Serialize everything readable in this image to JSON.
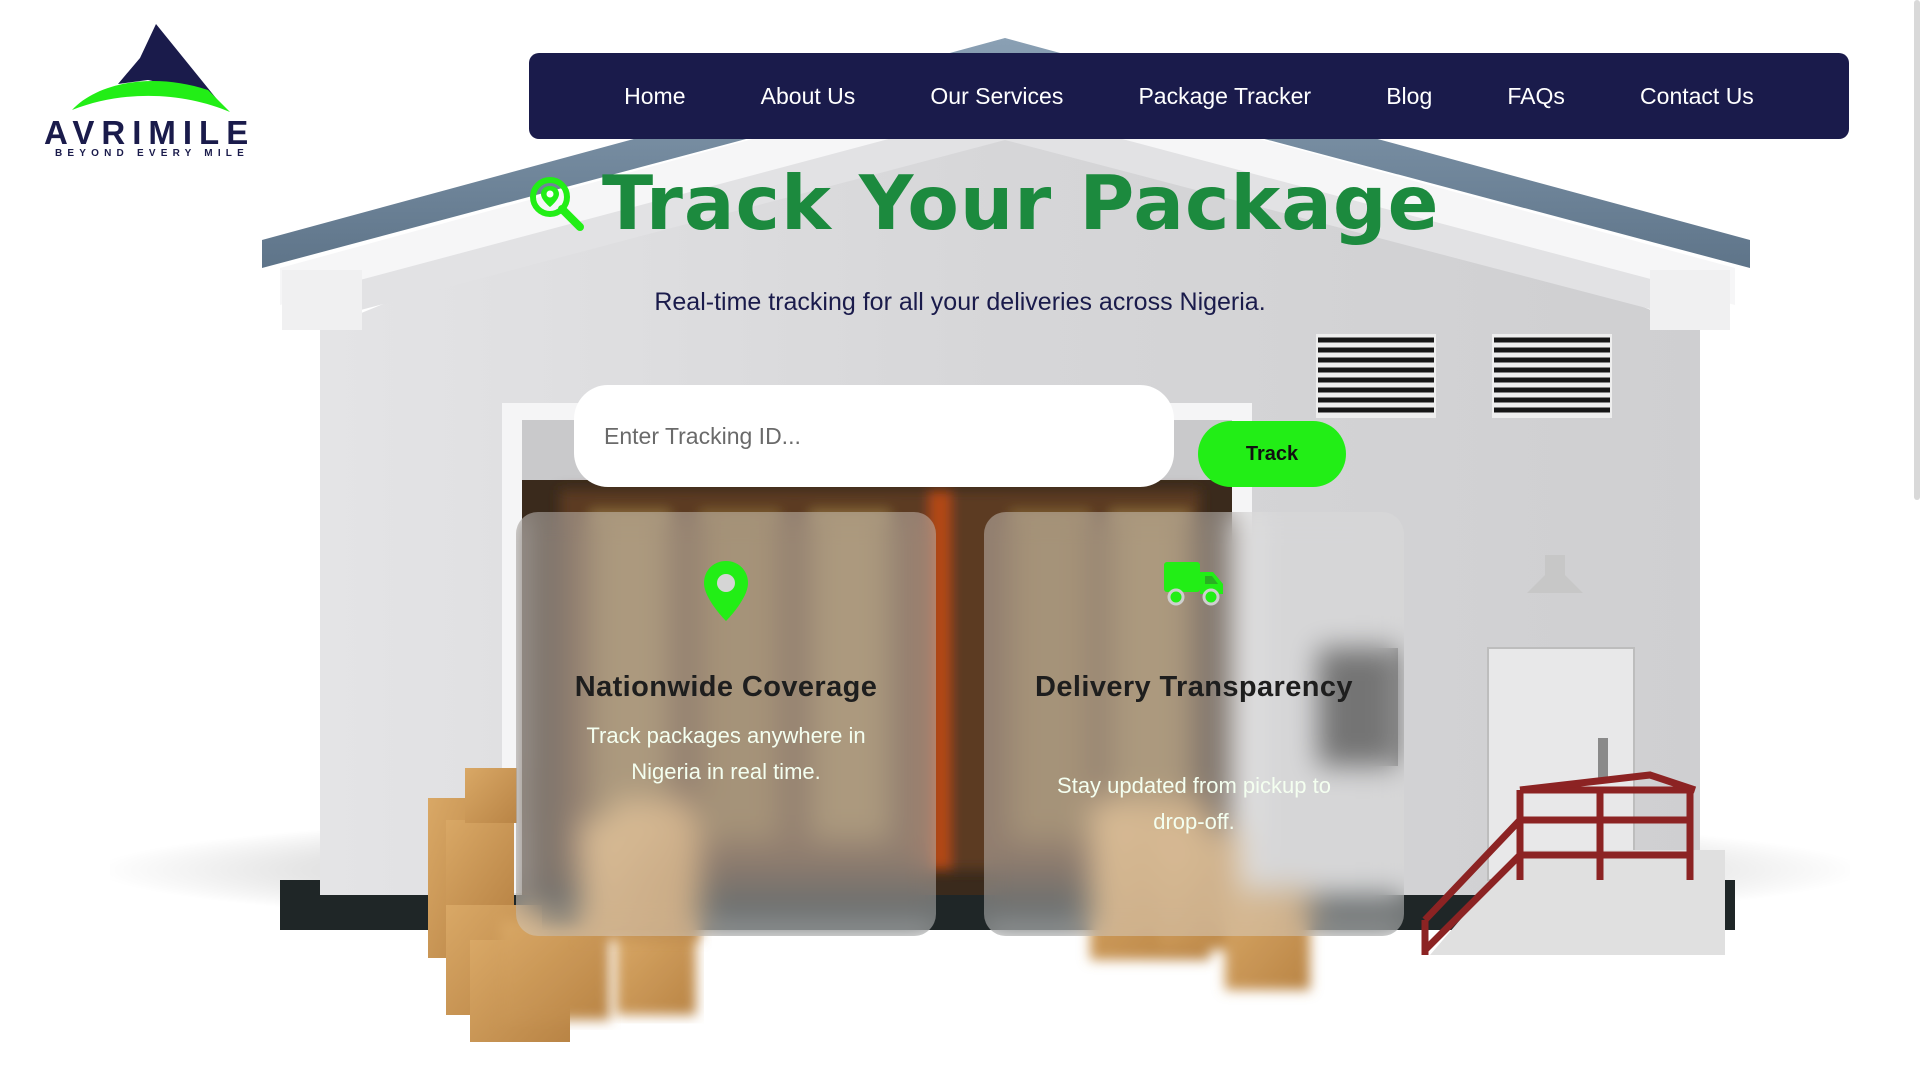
{
  "brand": {
    "name": "AVRIMILE",
    "tagline": "BEYOND EVERY MILE",
    "colors": {
      "navy": "#1a1b4b",
      "green": "#22ee16",
      "title_green": "#1c8a3e"
    }
  },
  "nav": {
    "items": [
      {
        "label": "Home"
      },
      {
        "label": "About Us"
      },
      {
        "label": "Our Services"
      },
      {
        "label": "Package Tracker"
      },
      {
        "label": "Blog"
      },
      {
        "label": "FAQs"
      },
      {
        "label": "Contact Us"
      }
    ]
  },
  "hero": {
    "icon": "search-location-icon",
    "title": "Track Your Package",
    "subtitle": "Real-time tracking for all your deliveries across Nigeria."
  },
  "tracker": {
    "placeholder": "Enter Tracking ID...",
    "value": "",
    "button_label": "Track"
  },
  "features": [
    {
      "icon": "map-pin-icon",
      "title": "Nationwide Coverage",
      "description": "Track packages anywhere in Nigeria in real time."
    },
    {
      "icon": "delivery-truck-icon",
      "title": "Delivery Transparency",
      "description": "Stay updated from pickup to drop-off."
    }
  ]
}
